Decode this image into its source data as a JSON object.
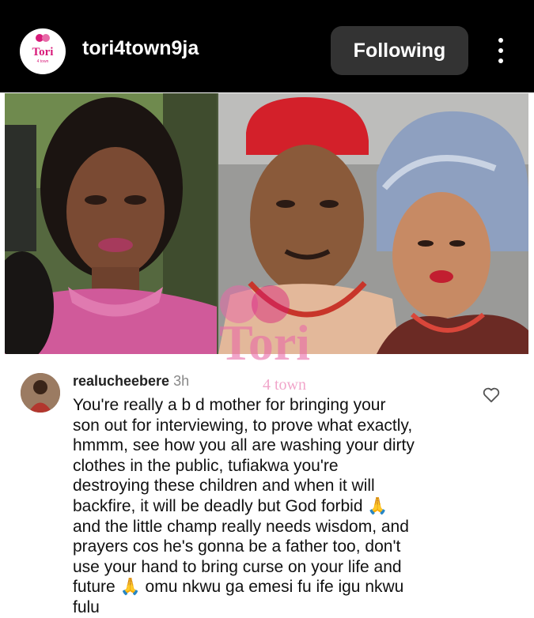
{
  "header": {
    "logo_text": "Tori",
    "logo_subtext": "4 town",
    "username": "tori4town9ja",
    "follow_label": "Following"
  },
  "photo": {
    "watermark_text": "Tori",
    "watermark_sub": "4 town"
  },
  "comment": {
    "username": "realucheebere",
    "time": "3h",
    "text": "You're really a b d mother for bringing your\nson out for interviewing, to prove what exactly,\nhmmm, see how you all are washing your dirty\nclothes in the public, tufiakwa you're\ndestroying these children and when it will\nbackfire, it will be deadly but God forbid 🙏\nand the little champ really needs wisdom, and\nprayers cos he's gonna be a father too, don't\nuse your hand to bring curse on your life and\nfuture 🙏 omu nkwu ga emesi fu ife igu nkwu\nfulu"
  },
  "colors": {
    "header_bg": "#000000",
    "button_bg": "#333333",
    "brand": "#d81b7a"
  }
}
